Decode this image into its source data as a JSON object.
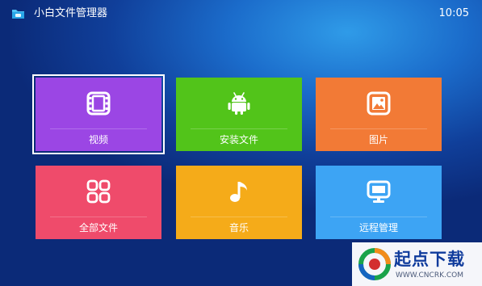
{
  "header": {
    "app_title": "小白文件管理器",
    "clock": "10:05",
    "app_icon": "folder-icon"
  },
  "tiles": [
    {
      "label": "视频",
      "icon": "film-icon",
      "color": "#9b46e4",
      "focused": true
    },
    {
      "label": "安装文件",
      "icon": "android-icon",
      "color": "#52c41a",
      "focused": false
    },
    {
      "label": "图片",
      "icon": "image-icon",
      "color": "#f27a36",
      "focused": false
    },
    {
      "label": "全部文件",
      "icon": "grid-icon",
      "color": "#ef4b6b",
      "focused": false
    },
    {
      "label": "音乐",
      "icon": "music-note-icon",
      "color": "#f5ab19",
      "focused": false
    },
    {
      "label": "远程管理",
      "icon": "monitor-icon",
      "color": "#3da4f4",
      "focused": false
    }
  ],
  "watermark": {
    "brand": "起点下载",
    "url": "WWW.CNCRK.COM"
  }
}
